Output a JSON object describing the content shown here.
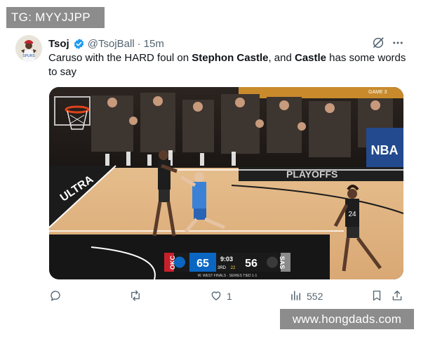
{
  "watermark_top": "TG: MYYJJPP",
  "watermark_bottom": "www.hongdads.com",
  "tweet": {
    "name": "Tsoj",
    "handle": "@TsojBall",
    "time": "15m",
    "text_parts": {
      "p1": "Caruso with the HARD foul on ",
      "bold1": "Stephon Castle",
      "p2": ", and ",
      "bold2": "Castle",
      "p3": " has some words to say"
    }
  },
  "media": {
    "court_text": "ULTRA",
    "playoffs_text": "PLAYOFFS",
    "corner_text": "GAME 3",
    "logo_text": "NBA",
    "scorebug": {
      "team_left": "OKC",
      "score_left": "65",
      "clock": "9:03",
      "period": "3RD",
      "shot_clock": "22",
      "score_right": "56",
      "team_right": "SAS",
      "series": "W. WEST FINALS · SERIES TIED 1-1"
    }
  },
  "actions": {
    "reply_count": "",
    "retweet_count": "",
    "like_count": "1",
    "views_count": "552"
  },
  "icons": [
    "verified-icon",
    "grok-icon",
    "more-icon",
    "reply-icon",
    "retweet-icon",
    "like-icon",
    "views-icon",
    "bookmark-icon",
    "share-icon"
  ]
}
